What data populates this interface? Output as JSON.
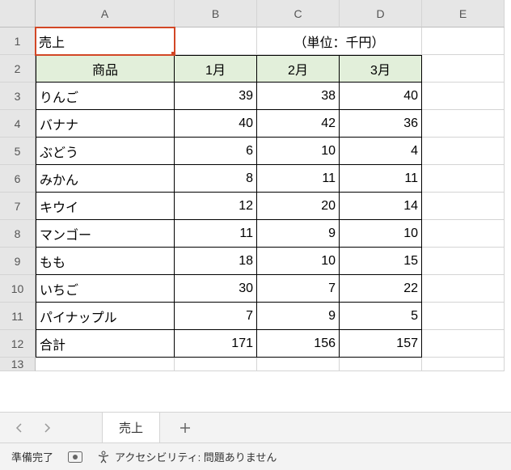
{
  "columns": [
    "A",
    "B",
    "C",
    "D",
    "E"
  ],
  "rows": [
    "1",
    "2",
    "3",
    "4",
    "5",
    "6",
    "7",
    "8",
    "9",
    "10",
    "11",
    "12",
    "13"
  ],
  "title_cell": "売上",
  "unit_label": "（単位：千円）",
  "header_row": {
    "product": "商品",
    "m1": "1月",
    "m2": "2月",
    "m3": "3月"
  },
  "data_rows": [
    {
      "name": "りんご",
      "m1": "39",
      "m2": "38",
      "m3": "40"
    },
    {
      "name": "バナナ",
      "m1": "40",
      "m2": "42",
      "m3": "36"
    },
    {
      "name": "ぶどう",
      "m1": "6",
      "m2": "10",
      "m3": "4"
    },
    {
      "name": "みかん",
      "m1": "8",
      "m2": "11",
      "m3": "11"
    },
    {
      "name": "キウイ",
      "m1": "12",
      "m2": "20",
      "m3": "14"
    },
    {
      "name": "マンゴー",
      "m1": "11",
      "m2": "9",
      "m3": "10"
    },
    {
      "name": "もも",
      "m1": "18",
      "m2": "10",
      "m3": "15"
    },
    {
      "name": "いちご",
      "m1": "30",
      "m2": "7",
      "m3": "22"
    },
    {
      "name": "パイナップル",
      "m1": "7",
      "m2": "9",
      "m3": "5"
    },
    {
      "name": "合計",
      "m1": "171",
      "m2": "156",
      "m3": "157"
    }
  ],
  "sheet_tab": "売上",
  "status": {
    "ready": "準備完了",
    "a11y": "アクセシビリティ: 問題ありません"
  }
}
